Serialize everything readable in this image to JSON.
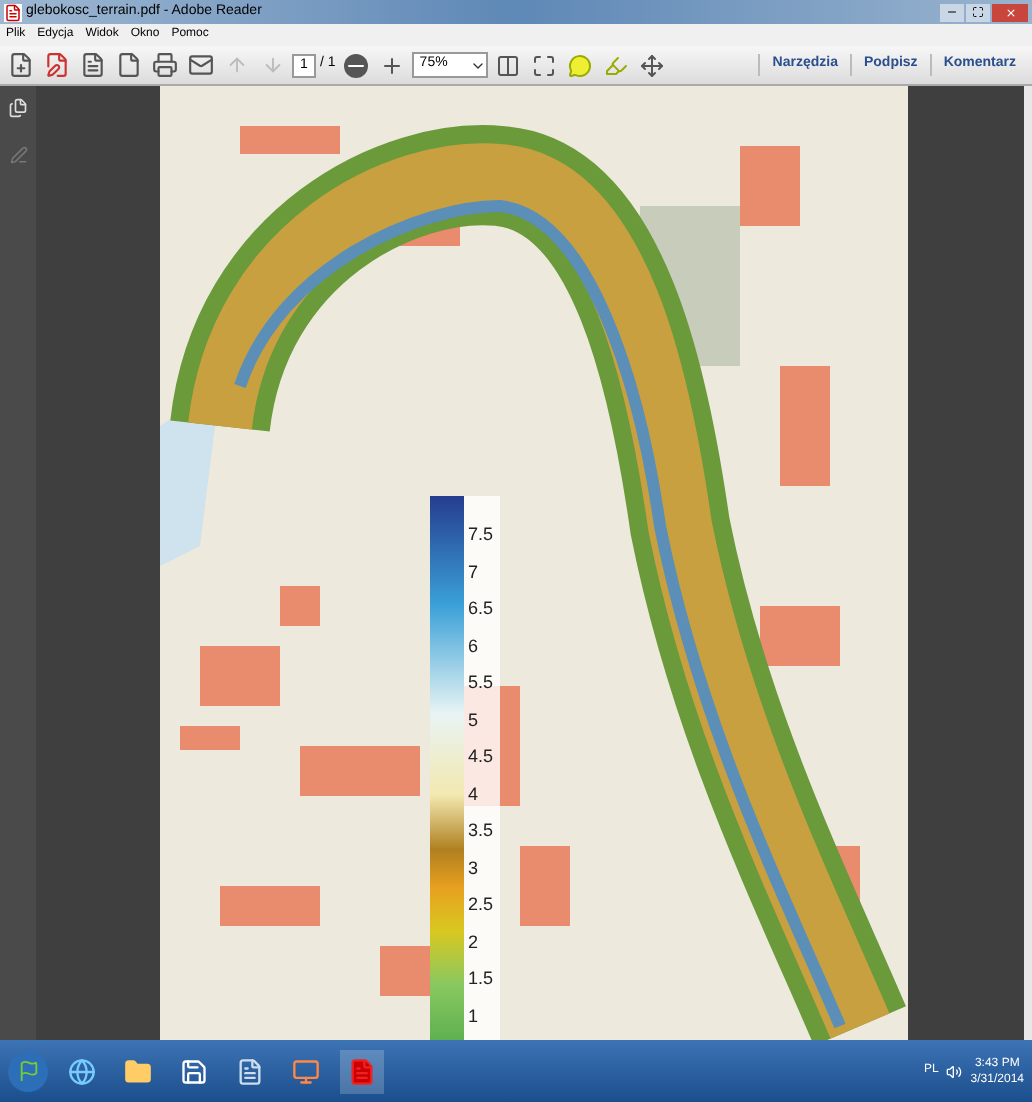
{
  "window": {
    "title": "glebokosc_terrain.pdf - Adobe Reader"
  },
  "menu": [
    "Plik",
    "Edycja",
    "Widok",
    "Okno",
    "Pomoc"
  ],
  "toolbar": {
    "page": "1",
    "page_count": "/ 1",
    "zoom": "75%"
  },
  "panels": [
    "Narzędzia",
    "Podpisz",
    "Komentarz"
  ],
  "document": {
    "legend": [
      "7.5",
      "7",
      "6.5",
      "6",
      "5.5",
      "5",
      "4.5",
      "4",
      "3.5",
      "3",
      "2.5",
      "2",
      "1.5",
      "1"
    ]
  },
  "taskbar": {
    "language": "PL",
    "time": "3:43 PM",
    "date": "3/31/2014"
  }
}
